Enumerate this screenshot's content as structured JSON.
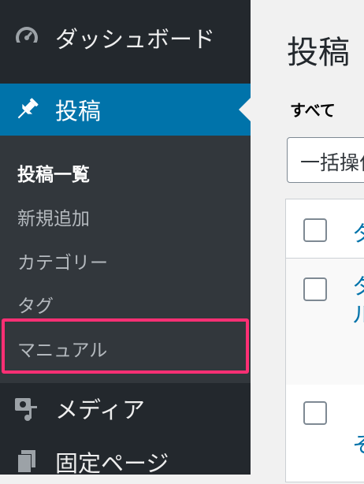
{
  "sidebar": {
    "dashboard_label": "ダッシュボード",
    "posts_label": "投稿",
    "submenu": {
      "all_posts": "投稿一覧",
      "add_new": "新規追加",
      "categories": "カテゴリー",
      "tags": "タグ",
      "manual": "マニュアル"
    },
    "media_label": "メディア",
    "pages_label": "固定ページ"
  },
  "main": {
    "title": "投稿",
    "filter_all": "すべて",
    "bulk_actions": "一括操作",
    "table": {
      "header_title_fragment": "タ",
      "row1_title_fragment": "タ\nル",
      "row2_title_fragment": "そ"
    }
  },
  "colors": {
    "sidebar_bg": "#23282d",
    "submenu_bg": "#32373c",
    "active_blue": "#0073aa",
    "highlight_pink": "#ff2f74"
  }
}
